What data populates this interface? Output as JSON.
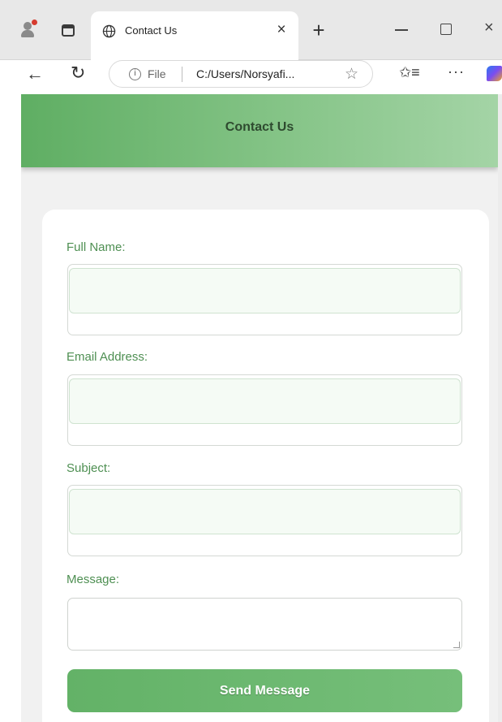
{
  "browser": {
    "tab_title": "Contact Us",
    "tab_close": "×",
    "new_tab": "+",
    "window_close": "×",
    "address_prefix": "File",
    "address_url": "C:/Users/Norsyafi...",
    "info_glyph": "i",
    "more_menu": "···",
    "icons": {
      "profile": "profile-icon",
      "tabs": "tab-actions-icon",
      "tab_favicon": "globe-icon",
      "back": "back-arrow-icon",
      "reload": "reload-icon",
      "favorite": "star-icon",
      "favorites_list": "favorites-icon",
      "copilot": "copilot-icon"
    }
  },
  "page": {
    "header_title": "Contact Us",
    "form": {
      "full_name_label": "Full Name:",
      "full_name_value": "",
      "email_label": "Email Address:",
      "email_value": "",
      "subject_label": "Subject:",
      "subject_value": "",
      "message_label": "Message:",
      "message_value": "",
      "submit_label": "Send Message"
    }
  },
  "colors": {
    "accent_green": "#63b267",
    "label_green": "#4e8f52",
    "header_text": "#2e4a2f"
  }
}
